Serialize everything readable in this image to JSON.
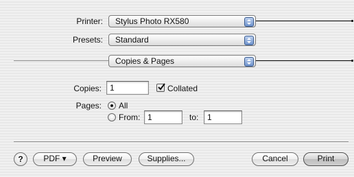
{
  "printer": {
    "label": "Printer:",
    "value": "Stylus Photo RX580"
  },
  "presets": {
    "label": "Presets:",
    "value": "Standard"
  },
  "pane": {
    "value": "Copies & Pages"
  },
  "copies": {
    "label": "Copies:",
    "value": "1",
    "collated_label": "Collated",
    "collated_checked": true
  },
  "pages": {
    "label": "Pages:",
    "all_label": "All",
    "from_label": "From:",
    "from_value": "1",
    "to_label": "to:",
    "to_value": "1",
    "selected": "all"
  },
  "buttons": {
    "help": "?",
    "pdf": "PDF ▾",
    "preview": "Preview",
    "supplies": "Supplies...",
    "cancel": "Cancel",
    "print": "Print"
  },
  "icons": {
    "popup_arrows": "up-down-arrows-icon",
    "checkmark": "checkmark-icon",
    "help": "question-mark-icon"
  },
  "colors": {
    "accent_blue": "#6f93cd",
    "background": "#ececec"
  }
}
